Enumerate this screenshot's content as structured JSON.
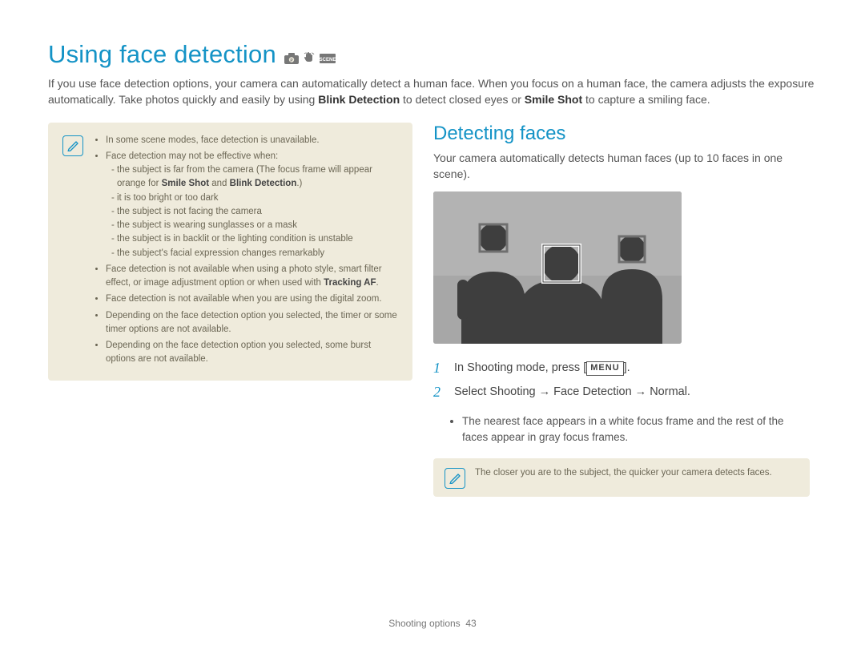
{
  "title": "Using face detection",
  "mode_icons": [
    "camera-p-icon",
    "hand-icon",
    "scene-icon"
  ],
  "intro_parts": {
    "p1": "If you use face detection options, your camera can automatically detect a human face. When you focus on a human face, the camera adjusts the exposure automatically. Take photos quickly and easily by using ",
    "b1": "Blink Detection",
    "p2": " to detect closed eyes or ",
    "b2": "Smile Shot",
    "p3": " to capture a smiling face."
  },
  "left_note": {
    "items": [
      {
        "text": "In some scene modes, face detection is unavailable."
      },
      {
        "text": "Face detection may not be effective when:",
        "sub": [
          {
            "pre": "the subject is far from the camera (The focus frame will appear orange for ",
            "b1": "Smile Shot",
            "mid": " and ",
            "b2": "Blink Detection",
            "post": ".)"
          },
          {
            "pre": "it is too bright or too dark"
          },
          {
            "pre": "the subject is not facing the camera"
          },
          {
            "pre": "the subject is wearing sunglasses or a mask"
          },
          {
            "pre": "the subject is in backlit or the lighting condition is unstable"
          },
          {
            "pre": "the subject's facial expression changes remarkably"
          }
        ]
      },
      {
        "text_pre": "Face detection is not available when using a photo style, smart filter effect, or image adjustment option or when used with ",
        "b": "Tracking AF",
        "text_post": "."
      },
      {
        "text": "Face detection is not available when you are using the digital zoom."
      },
      {
        "text": "Depending on the face detection option you selected, the timer or some timer options are not available."
      },
      {
        "text": "Depending on the face detection option you selected, some burst options are not available."
      }
    ]
  },
  "right": {
    "heading": "Detecting faces",
    "paragraph": "Your camera automatically detects human faces (up to 10 faces in one scene).",
    "steps": [
      {
        "n": "1",
        "text_pre": "In Shooting mode, press ",
        "chip": "MENU",
        "text_post": "."
      },
      {
        "n": "2",
        "text_pre": "Select Shooting → Face Detection → Normal."
      }
    ],
    "step2_sub": "The nearest face appears in a white focus frame and the rest of the faces appear in gray focus frames.",
    "tip": "The closer you are to the subject, the quicker your camera detects faces."
  },
  "footer": {
    "section": "Shooting options",
    "page": "43"
  }
}
